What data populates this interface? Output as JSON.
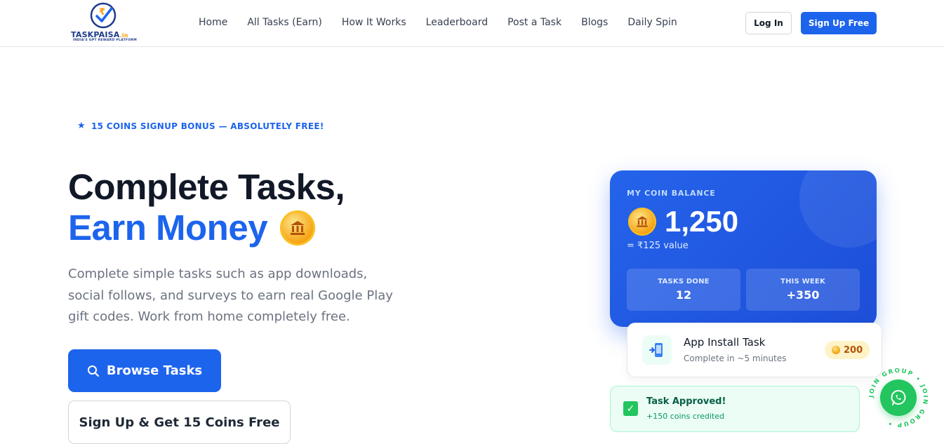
{
  "header": {
    "logo": {
      "name": "TASKPAISA",
      "suffix": ".in",
      "tagline": "INDIA'S GPT REWARD PLATFORM"
    },
    "nav": [
      "Home",
      "All Tasks (Earn)",
      "How It Works",
      "Leaderboard",
      "Post a Task",
      "Blogs",
      "Daily Spin"
    ],
    "login_label": "Log In",
    "signup_label": "Sign Up Free"
  },
  "hero": {
    "badge": "15 COINS SIGNUP BONUS — ABSOLUTELY FREE!",
    "title_line1": "Complete Tasks,",
    "title_line2": "Earn Money",
    "lead": "Complete simple tasks such as app downloads, social follows, and surveys to earn real Google Play gift codes. Work from home completely free.",
    "browse_label": "Browse Tasks",
    "signup_cta": "Sign Up & Get 15 Coins Free"
  },
  "balance_card": {
    "label": "MY COIN BALANCE",
    "value": "1,250",
    "sub": "= ₹125 value",
    "stats": [
      {
        "label": "TASKS DONE",
        "value": "12"
      },
      {
        "label": "THIS WEEK",
        "value": "+350"
      }
    ]
  },
  "task_card": {
    "title": "App Install Task",
    "subtitle": "Complete in ~5 minutes",
    "reward": "200"
  },
  "approved_card": {
    "title": "Task Approved!",
    "subtitle": "+150 coins credited"
  },
  "whatsapp": {
    "ring_text": "JOIN GROUP • JOIN GROUP •"
  },
  "colors": {
    "primary": "#1d64ed",
    "success": "#22c55e",
    "coin": "#f59e0b"
  }
}
